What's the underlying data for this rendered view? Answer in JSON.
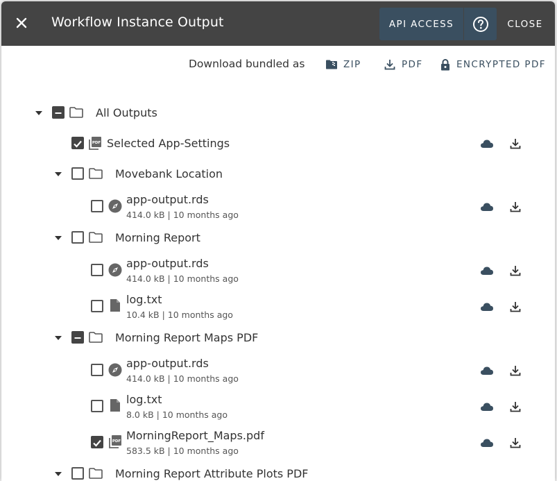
{
  "header": {
    "title": "Workflow Instance Output",
    "api_access_label": "API ACCESS",
    "close_label": "CLOSE"
  },
  "download_bar": {
    "label": "Download bundled as",
    "zip_label": "ZIP",
    "pdf_label": "PDF",
    "encrypted_pdf_label": "ENCRYPTED PDF"
  },
  "tree": {
    "root_label": "All Outputs",
    "items": [
      {
        "label": "Selected App-Settings",
        "state": "checked"
      },
      {
        "label": "Movebank Location",
        "state": "unchecked"
      },
      {
        "label": "app-output.rds",
        "meta": "414.0 kB | 10 months ago",
        "state": "unchecked"
      },
      {
        "label": "Morning Report",
        "state": "unchecked"
      },
      {
        "label": "app-output.rds",
        "meta": "414.0 kB | 10 months ago",
        "state": "unchecked"
      },
      {
        "label": "log.txt",
        "meta": "10.4 kB | 10 months ago",
        "state": "unchecked"
      },
      {
        "label": "Morning Report Maps PDF",
        "state": "indeterminate"
      },
      {
        "label": "app-output.rds",
        "meta": "414.0 kB | 10 months ago",
        "state": "unchecked"
      },
      {
        "label": "log.txt",
        "meta": "8.0 kB | 10 months ago",
        "state": "unchecked"
      },
      {
        "label": "MorningReport_Maps.pdf",
        "meta": "583.5 kB | 10 months ago",
        "state": "checked"
      },
      {
        "label": "Morning Report Attribute Plots PDF",
        "state": "unchecked"
      }
    ]
  },
  "colors": {
    "header_bg": "#444444",
    "accent_button": "#3a4f60",
    "icon_dark": "#3a4f60"
  }
}
